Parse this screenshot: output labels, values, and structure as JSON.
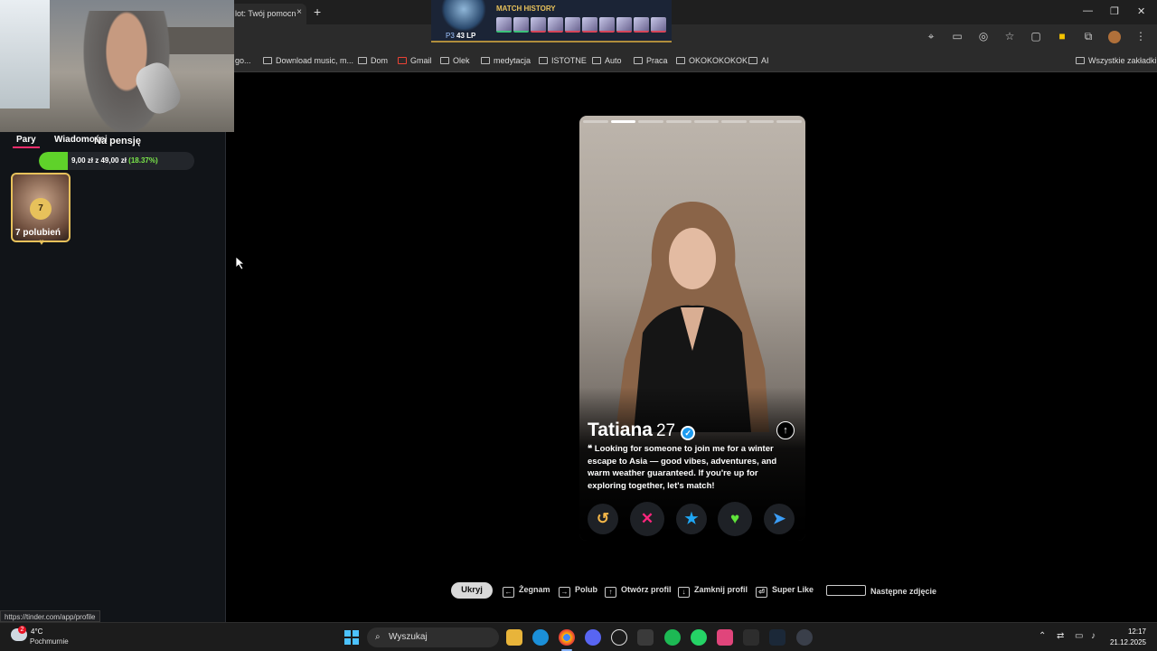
{
  "browser": {
    "tab_title": "lot: Twój pomocn",
    "tab_close": "×",
    "new_tab": "+",
    "win_min": "—",
    "win_max": "❐",
    "win_close": "✕"
  },
  "bookmarks": [
    {
      "label": "go...",
      "icon": "page-icon"
    },
    {
      "label": "Download music, m...",
      "icon": "page-icon"
    },
    {
      "label": "Dom",
      "icon": "folder-icon"
    },
    {
      "label": "Gmail",
      "icon": "gmail-icon"
    },
    {
      "label": "Olek",
      "icon": "folder-icon"
    },
    {
      "label": "medytacja",
      "icon": "folder-icon"
    },
    {
      "label": "ISTOTNE",
      "icon": "folder-icon"
    },
    {
      "label": "Auto",
      "icon": "folder-icon"
    },
    {
      "label": "Praca",
      "icon": "folder-icon"
    },
    {
      "label": "OKOKOKOKOK",
      "icon": "folder-icon"
    },
    {
      "label": "AI",
      "icon": "folder-icon"
    },
    {
      "label": "Wszystkie zakładki",
      "icon": "folder-icon"
    }
  ],
  "match_history": {
    "title": "MATCH HISTORY",
    "rank_prefix": "P3",
    "rank_lp": "43 LP",
    "results": [
      "win",
      "win",
      "loss",
      "loss",
      "loss",
      "loss",
      "loss",
      "loss",
      "loss",
      "loss"
    ]
  },
  "sidebar": {
    "tabs": [
      "Pary",
      "Wiadomości"
    ],
    "overlay_title": "Na pensję",
    "goal": {
      "text": "9,00 zł",
      "of": "z 49,00 zł",
      "percent_text": "(18.37%)",
      "fraction": 0.1837
    },
    "likes": {
      "count": "7",
      "label": "7 polubień"
    }
  },
  "profile": {
    "name": "Tatiana",
    "age": "27",
    "bio_quote": "❝",
    "bio": "Looking for someone to join me for a winter escape to Asia — good vibes, adventures, and warm weather guaranteed. If you're up for exploring together, let's match!",
    "photo_count": 8,
    "active_photo": 1
  },
  "actions": [
    {
      "name": "rewind-button",
      "icon": "↺",
      "color": "#f5b748"
    },
    {
      "name": "nope-button",
      "icon": "✕",
      "color": "#fd267d"
    },
    {
      "name": "super-like-button",
      "icon": "★",
      "color": "#1fa6f3"
    },
    {
      "name": "like-button",
      "icon": "♥",
      "color": "#5fe33a"
    },
    {
      "name": "boost-button",
      "icon": "➤",
      "color": "#3b9df6"
    }
  ],
  "shortcuts": {
    "hide": "Ukryj",
    "items": [
      {
        "key": "←",
        "label": "Żegnam"
      },
      {
        "key": "→",
        "label": "Polub"
      },
      {
        "key": "↑",
        "label": "Otwórz profil"
      },
      {
        "key": "↓",
        "label": "Zamknij profil"
      },
      {
        "key": "⏎",
        "label": "Super Like"
      },
      {
        "key": "",
        "label": "Następne zdjęcie"
      }
    ]
  },
  "status_url": "https://tinder.com/app/profile",
  "taskbar": {
    "weather_badge": "2",
    "temperature": "4°C",
    "weather_desc": "Pochmurnie",
    "search_placeholder": "Wyszukaj",
    "time": "12:17",
    "date": "21.12.2025"
  },
  "colors": {
    "accent": "#fd2d6c",
    "gold": "#e7c15b",
    "progress": "#5fd22a"
  }
}
